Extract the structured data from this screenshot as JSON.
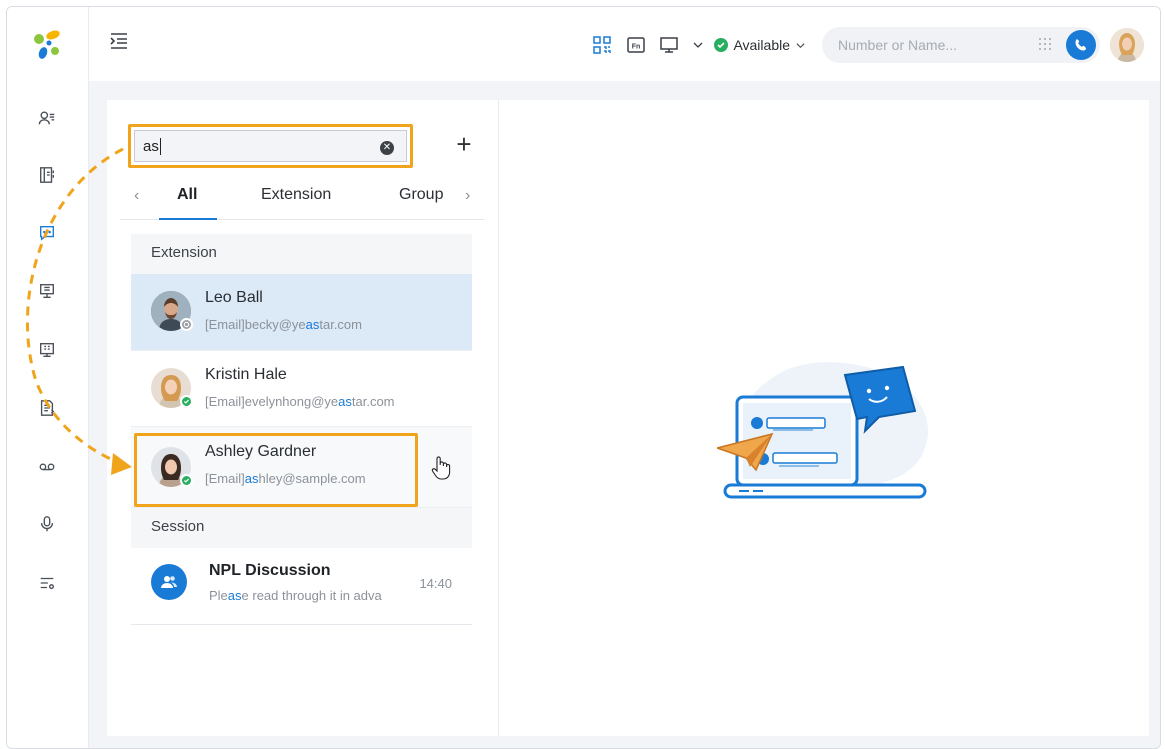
{
  "topbar": {
    "status_label": "Available",
    "dial_placeholder": "Number or Name..."
  },
  "search": {
    "value": "as"
  },
  "tabs": [
    {
      "label": "All",
      "active": true
    },
    {
      "label": "Extension"
    },
    {
      "label": "Group"
    }
  ],
  "sections": {
    "extension": "Extension",
    "session": "Session"
  },
  "extension_results": [
    {
      "name": "Leo Ball",
      "email_prefix": "[Email]becky@ye",
      "email_match": "as",
      "email_suffix": "tar.com",
      "presence": "gray"
    },
    {
      "name": "Kristin Hale",
      "email_prefix": "[Email]evelynhong@ye",
      "email_match": "as",
      "email_suffix": "tar.com",
      "presence": "green"
    },
    {
      "name": "Ashley Gardner",
      "email_prefix": "[Email]",
      "email_match": "as",
      "email_suffix": "hley@sample.com",
      "presence": "green"
    }
  ],
  "session_results": [
    {
      "title": "NPL Discussion",
      "time": "14:40",
      "preview_prefix": "Ple",
      "preview_match": "as",
      "preview_suffix": "e read through it in adva"
    }
  ],
  "colors": {
    "accent": "#1a7bd6",
    "highlight": "#f0a41c",
    "online": "#27ae60"
  }
}
